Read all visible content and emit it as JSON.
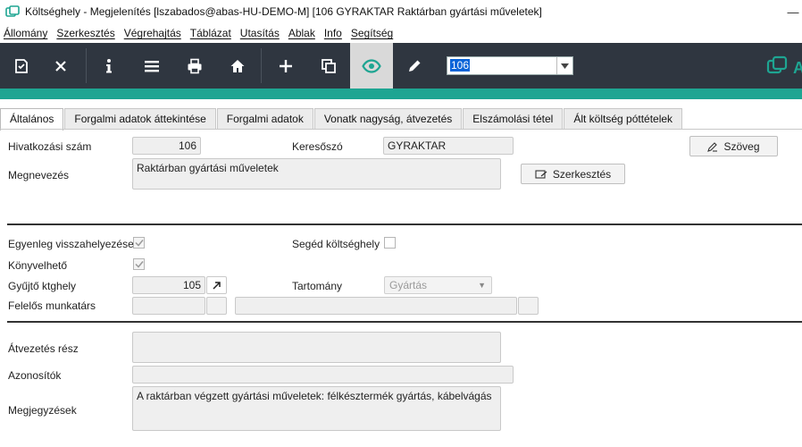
{
  "window": {
    "title": "Költséghely - Megjelenítés  [lszabados@abas-HU-DEMO-M]  [106  GYRAKTAR  Raktárban gyártási műveletek]",
    "minimize_glyph": "—"
  },
  "menu": {
    "items": [
      "Állomány",
      "Szerkesztés",
      "Végrehajtás",
      "Táblázat",
      "Utasítás",
      "Ablak",
      "Info",
      "Segítség"
    ]
  },
  "toolbar": {
    "id_value": "106",
    "logo_text": "A",
    "colors": {
      "background": "#2f3640",
      "accent": "#1ea592",
      "active": "#d9d9d9"
    },
    "icons": [
      "save-icon",
      "close-icon",
      "info-icon",
      "list-icon",
      "print-icon",
      "home-icon",
      "add-icon",
      "copy-icon",
      "view-icon",
      "edit-icon",
      "chevron-down-icon"
    ]
  },
  "tabs": [
    {
      "label": "Általános",
      "active": true
    },
    {
      "label": "Forgalmi adatok áttekintése",
      "active": false
    },
    {
      "label": "Forgalmi adatok",
      "active": false
    },
    {
      "label": "Vonatk nagyság, átvezetés",
      "active": false
    },
    {
      "label": "Elszámolási tétel",
      "active": false
    },
    {
      "label": "Ált költség póttételek",
      "active": false
    }
  ],
  "form": {
    "hivatkozasi_szam_label": "Hivatkozási szám",
    "hivatkozasi_szam_value": "106",
    "keresoszo_label": "Keresőszó",
    "keresoszo_value": "GYRAKTAR",
    "szoveg_button": "Szöveg",
    "megnevezes_label": "Megnevezés",
    "megnevezes_value": "Raktárban gyártási műveletek",
    "szerkesztes_button": "Szerkesztés",
    "egyenleg_label": "Egyenleg visszahelyezése",
    "egyenleg_checked": true,
    "seged_label": "Segéd költséghely",
    "seged_checked": false,
    "konyvelheto_label": "Könyvelhető",
    "konyvelheto_checked": true,
    "gyujto_label": "Gyűjtő ktghely",
    "gyujto_value": "105",
    "tartomany_label": "Tartomány",
    "tartomany_value": "Gyártás",
    "felelos_label": "Felelős munkatárs",
    "felelos_value": "",
    "felelos_name": "",
    "atvezetes_label": "Átvezetés rész",
    "atvezetes_value": "",
    "azonositok_label": "Azonosítók",
    "azonositok_value": "",
    "megjegyzesek_label": "Megjegyzések",
    "megjegyzesek_value": "A raktárban végzett gyártási műveletek: félkésztermék gyártás, kábelvágás"
  }
}
